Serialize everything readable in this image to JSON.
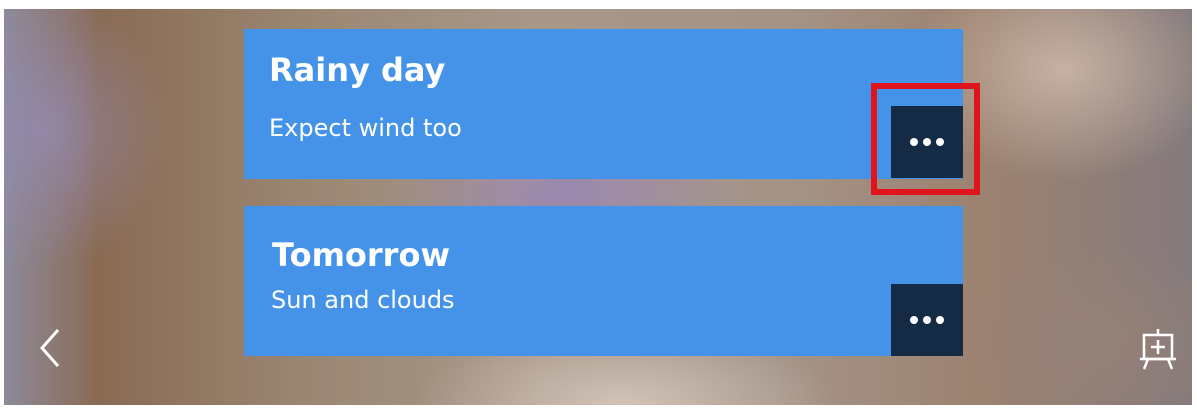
{
  "cards": [
    {
      "title": "Rainy day",
      "subtitle": "Expect wind too",
      "more_icon": "ellipsis-icon"
    },
    {
      "title": "Tomorrow",
      "subtitle": "Sun and clouds",
      "more_icon": "ellipsis-icon"
    }
  ],
  "nav": {
    "back_icon": "chevron-left-icon",
    "present_icon": "presentation-board-icon"
  },
  "colors": {
    "card_background": "#4493e8",
    "more_button_background": "#152a44",
    "highlight_border": "#e0141c",
    "text": "#ffffff"
  }
}
